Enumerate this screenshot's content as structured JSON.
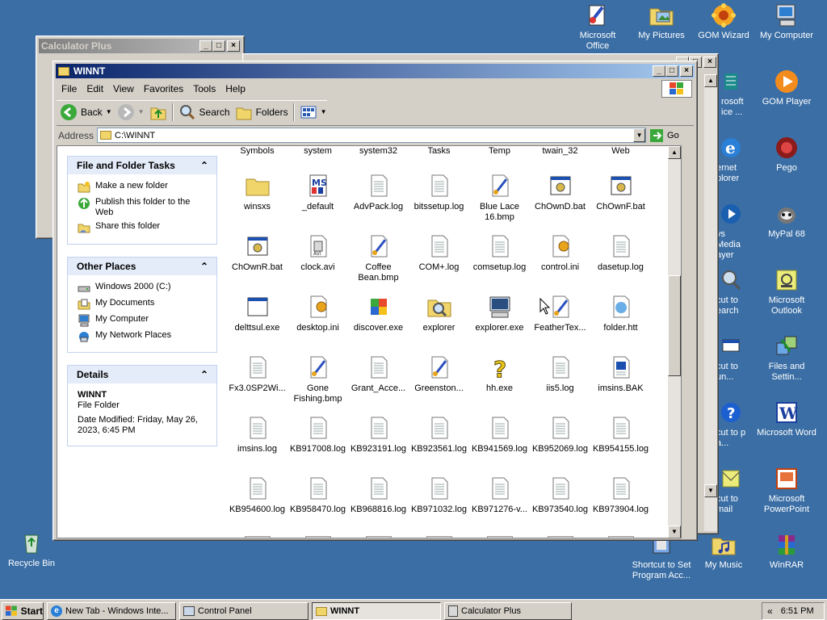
{
  "desktop": {
    "icons_right": [
      {
        "label": "Microsoft Office",
        "icon": "office-icon"
      },
      {
        "label": "My Pictures",
        "icon": "pictures-icon"
      },
      {
        "label": "GOM Wizard",
        "icon": "gom-wizard-icon"
      },
      {
        "label": "My Computer",
        "icon": "computer-icon"
      },
      {
        "label": "GOM Player",
        "icon": "gom-player-icon"
      },
      {
        "label": "Pego",
        "icon": "pego-icon"
      },
      {
        "label": "MyPal 68",
        "icon": "mypal-icon"
      },
      {
        "label": "Microsoft Outlook",
        "icon": "outlook-icon"
      },
      {
        "label": "Files and Settin...",
        "icon": "files-settings-icon"
      },
      {
        "label": "Microsoft Word",
        "icon": "word-icon"
      },
      {
        "label": "Microsoft PowerPoint",
        "icon": "powerpoint-icon"
      },
      {
        "label": "Shortcut to Set Program Acc...",
        "icon": "shortcut-icon"
      },
      {
        "label": "My Music",
        "icon": "music-icon"
      },
      {
        "label": "WinRAR",
        "icon": "winrar-icon"
      }
    ],
    "icons_partial": [
      {
        "label": "rosoft ice ...",
        "icon": "office-tools-icon"
      },
      {
        "label": "ernet plorer",
        "icon": "ie-icon"
      },
      {
        "label": "vs Media ayer",
        "icon": "media-player-icon"
      },
      {
        "label": "cut to earch",
        "icon": "search-icon"
      },
      {
        "label": "cut to un...",
        "icon": "run-icon"
      },
      {
        "label": "cut to p a...",
        "icon": "help-icon"
      },
      {
        "label": "cut to mail",
        "icon": "mail-icon"
      }
    ],
    "recycle_bin": "Recycle Bin"
  },
  "calculator": {
    "title": "Calculator Plus"
  },
  "explorer": {
    "title": "WINNT",
    "menu": [
      "File",
      "Edit",
      "View",
      "Favorites",
      "Tools",
      "Help"
    ],
    "toolbar": {
      "back": "Back",
      "search": "Search",
      "folders": "Folders"
    },
    "address": {
      "label": "Address",
      "value": "C:\\WINNT",
      "go": "Go"
    },
    "tasks": {
      "title": "File and Folder Tasks",
      "items": [
        "Make a new folder",
        "Publish this folder to the Web",
        "Share this folder"
      ]
    },
    "places": {
      "title": "Other Places",
      "items": [
        "Windows 2000 (C:)",
        "My Documents",
        "My Computer",
        "My Network Places"
      ]
    },
    "details": {
      "title": "Details",
      "name": "WINNT",
      "type": "File Folder",
      "modified": "Date Modified: Friday, May 26, 2023, 6:45 PM"
    },
    "top_row": [
      "Symbols",
      "system",
      "system32",
      "Tasks",
      "Temp",
      "twain_32",
      "Web"
    ],
    "files": [
      {
        "label": "winsxs",
        "icon": "folder-icon"
      },
      {
        "label": "_default",
        "icon": "ms-file-icon"
      },
      {
        "label": "AdvPack.log",
        "icon": "text-file-icon"
      },
      {
        "label": "bitssetup.log",
        "icon": "text-file-icon"
      },
      {
        "label": "Blue Lace 16.bmp",
        "icon": "paint-file-icon"
      },
      {
        "label": "ChOwnD.bat",
        "icon": "batch-file-icon"
      },
      {
        "label": "ChOwnF.bat",
        "icon": "batch-file-icon"
      },
      {
        "label": "ChOwnR.bat",
        "icon": "batch-file-icon"
      },
      {
        "label": "clock.avi",
        "icon": "avi-file-icon"
      },
      {
        "label": "Coffee Bean.bmp",
        "icon": "paint-file-icon"
      },
      {
        "label": "COM+.log",
        "icon": "text-file-icon"
      },
      {
        "label": "comsetup.log",
        "icon": "text-file-icon"
      },
      {
        "label": "control.ini",
        "icon": "ini-file-icon"
      },
      {
        "label": "dasetup.log",
        "icon": "text-file-icon"
      },
      {
        "label": "delttsul.exe",
        "icon": "exe-file-icon"
      },
      {
        "label": "desktop.ini",
        "icon": "ini-file-icon"
      },
      {
        "label": "discover.exe",
        "icon": "discover-icon"
      },
      {
        "label": "explorer",
        "icon": "explorer-folder-icon"
      },
      {
        "label": "explorer.exe",
        "icon": "explorer-exe-icon"
      },
      {
        "label": "FeatherTex...",
        "icon": "paint-file-icon"
      },
      {
        "label": "folder.htt",
        "icon": "htt-file-icon"
      },
      {
        "label": "Fx3.0SP2Wi...",
        "icon": "text-file-icon"
      },
      {
        "label": "Gone Fishing.bmp",
        "icon": "paint-file-icon"
      },
      {
        "label": "Grant_Acce...",
        "icon": "text-file-icon"
      },
      {
        "label": "Greenston...",
        "icon": "paint-file-icon"
      },
      {
        "label": "hh.exe",
        "icon": "help-file-icon"
      },
      {
        "label": "iis5.log",
        "icon": "text-file-icon"
      },
      {
        "label": "imsins.BAK",
        "icon": "bak-file-icon"
      },
      {
        "label": "imsins.log",
        "icon": "text-file-icon"
      },
      {
        "label": "KB917008.log",
        "icon": "text-file-icon"
      },
      {
        "label": "KB923191.log",
        "icon": "text-file-icon"
      },
      {
        "label": "KB923561.log",
        "icon": "text-file-icon"
      },
      {
        "label": "KB941569.log",
        "icon": "text-file-icon"
      },
      {
        "label": "KB952069.log",
        "icon": "text-file-icon"
      },
      {
        "label": "KB954155.log",
        "icon": "text-file-icon"
      },
      {
        "label": "KB954600.log",
        "icon": "text-file-icon"
      },
      {
        "label": "KB958470.log",
        "icon": "text-file-icon"
      },
      {
        "label": "KB968816.log",
        "icon": "text-file-icon"
      },
      {
        "label": "KB971032.log",
        "icon": "text-file-icon"
      },
      {
        "label": "KB971276-v...",
        "icon": "text-file-icon"
      },
      {
        "label": "KB973540.log",
        "icon": "text-file-icon"
      },
      {
        "label": "KB973904.log",
        "icon": "text-file-icon"
      }
    ]
  },
  "taskbar": {
    "start": "Start",
    "buttons": [
      {
        "label": "New Tab - Windows Inte...",
        "icon": "ie-icon"
      },
      {
        "label": "Control Panel",
        "icon": "control-panel-icon"
      },
      {
        "label": "WINNT",
        "icon": "folder-icon"
      },
      {
        "label": "Calculator Plus",
        "icon": "calculator-icon"
      }
    ],
    "clock": "6:51 PM"
  }
}
